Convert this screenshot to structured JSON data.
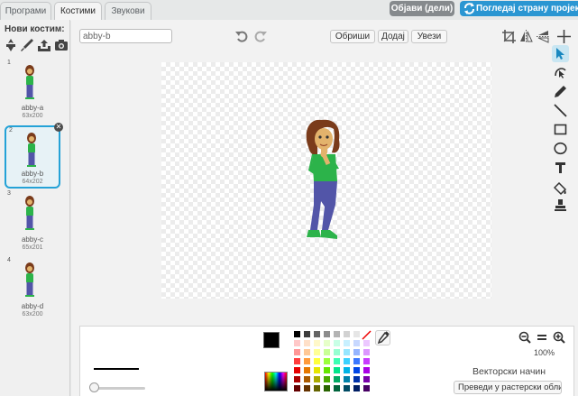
{
  "tabs": [
    {
      "label": "Програми"
    },
    {
      "label": "Костими"
    },
    {
      "label": "Звукови"
    }
  ],
  "header": {
    "share_label": "Објави (дели)",
    "project_page_label": "Погледај страну пројекта"
  },
  "costume_pane": {
    "new_costume_label": "Нови костим:",
    "new_icons": [
      "sprite-library-icon",
      "paintbrush-icon",
      "upload-icon",
      "camera-icon"
    ],
    "costumes": [
      {
        "number": "1",
        "name": "abby-a",
        "size": "63x200",
        "selected": false
      },
      {
        "number": "2",
        "name": "abby-b",
        "size": "64x202",
        "selected": true
      },
      {
        "number": "3",
        "name": "abby-c",
        "size": "65x201",
        "selected": false
      },
      {
        "number": "4",
        "name": "abby-d",
        "size": "63x200",
        "selected": false
      }
    ]
  },
  "editor": {
    "costume_name": "abby-b",
    "clear_label": "Обриши",
    "add_label": "Додај",
    "import_label": "Увези",
    "tools": [
      "select-arrow-icon",
      "reshape-icon",
      "pencil-icon",
      "line-icon",
      "rectangle-icon",
      "ellipse-icon",
      "text-icon",
      "fill-bucket-icon",
      "stamp-icon"
    ]
  },
  "bottom_panel": {
    "zoom_level": "100%",
    "mode_label": "Векторски начин",
    "convert_label": "Преведи у растерски облик",
    "palette_colors": [
      [
        "#000000",
        "#3c3c3c",
        "#646464",
        "#8c8c8c",
        "#b4b4b4",
        "#d2d2d2",
        "#e6e6e6",
        "#ffffff"
      ],
      [
        "#ffc8c8",
        "#ffe0c8",
        "#fff8c8",
        "#e6ffc8",
        "#c8ffe6",
        "#c8f0ff",
        "#c8d8ff",
        "#ecc8ff"
      ],
      [
        "#ff9696",
        "#ffc896",
        "#ffff96",
        "#c8ff96",
        "#96ffd2",
        "#96e6ff",
        "#96b4ff",
        "#dc96ff"
      ],
      [
        "#ff3c3c",
        "#ff9b3c",
        "#ffff3c",
        "#9bff3c",
        "#3cffb4",
        "#3cd2ff",
        "#3c78ff",
        "#c83cff"
      ],
      [
        "#e60000",
        "#e67800",
        "#e6e600",
        "#64e600",
        "#00e68c",
        "#00b4e6",
        "#0046e6",
        "#aa00e6"
      ],
      [
        "#aa0000",
        "#aa5a00",
        "#aaaa00",
        "#4baa00",
        "#00aa64",
        "#0082aa",
        "#0032aa",
        "#7800aa"
      ],
      [
        "#640000",
        "#643200",
        "#646400",
        "#286400",
        "#00643c",
        "#004b64",
        "#001e64",
        "#460064"
      ]
    ],
    "selected_color": "#000000"
  }
}
